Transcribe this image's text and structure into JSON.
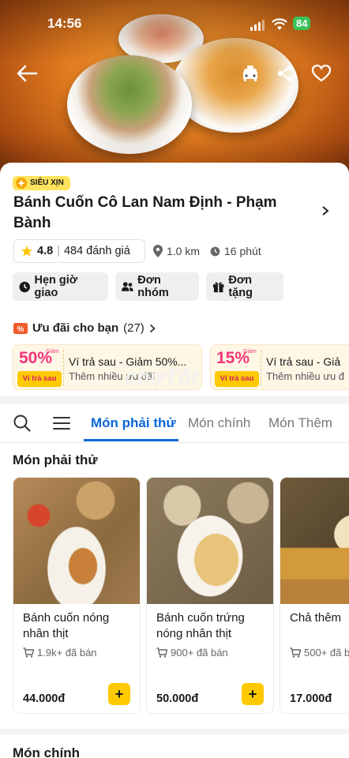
{
  "status_bar": {
    "time": "14:56",
    "battery": "84"
  },
  "shop": {
    "badge": "SIÊU XỊN",
    "name": "Bánh Cuốn Cô Lan Nam Định - Phạm Bành",
    "rating": "4.8",
    "review_count": "484 đánh giá",
    "distance": "1.0 km",
    "delivery_time": "16 phút"
  },
  "actions": [
    {
      "label": "Hẹn giờ giao",
      "icon": "clock-icon"
    },
    {
      "label": "Đơn nhóm",
      "icon": "group-icon"
    },
    {
      "label": "Đơn tặng",
      "icon": "gift-icon"
    }
  ],
  "offers": {
    "title": "Ưu đãi cho bạn",
    "count": "(27)",
    "vouchers": [
      {
        "percent": "50%",
        "giam": "Giảm",
        "wallet": "Ví trả sau",
        "title": "Ví trả sau - Giảm 50%...",
        "subtitle": "Thêm nhiều ưu đãi"
      },
      {
        "percent": "15%",
        "giam": "Giảm",
        "wallet": "Ví trả sau",
        "title": "Ví trả sau - Giả",
        "subtitle": "Thêm nhiều ưu đ"
      }
    ]
  },
  "watermark": "chợTốt",
  "tabs": [
    {
      "label": "Món phải thử",
      "active": true
    },
    {
      "label": "Món chính",
      "active": false
    },
    {
      "label": "Món Thêm",
      "active": false
    }
  ],
  "section": {
    "title": "Món phải thử",
    "items": [
      {
        "name": "Bánh cuốn nóng nhân thịt",
        "sold": "1.9k+ đã bán",
        "price": "44.000đ"
      },
      {
        "name": "Bánh cuốn trứng nóng nhân thịt",
        "sold": "900+ đã bán",
        "price": "50.000đ"
      },
      {
        "name": "Chả thêm",
        "sold": "500+ đã b",
        "price": "17.000đ"
      }
    ]
  },
  "next_section_title": "Món chính",
  "colors": {
    "accent": "#0a66d6",
    "add_button": "#ffc900",
    "badge": "#ffe35c",
    "voucher_pink": "#f2357a"
  }
}
